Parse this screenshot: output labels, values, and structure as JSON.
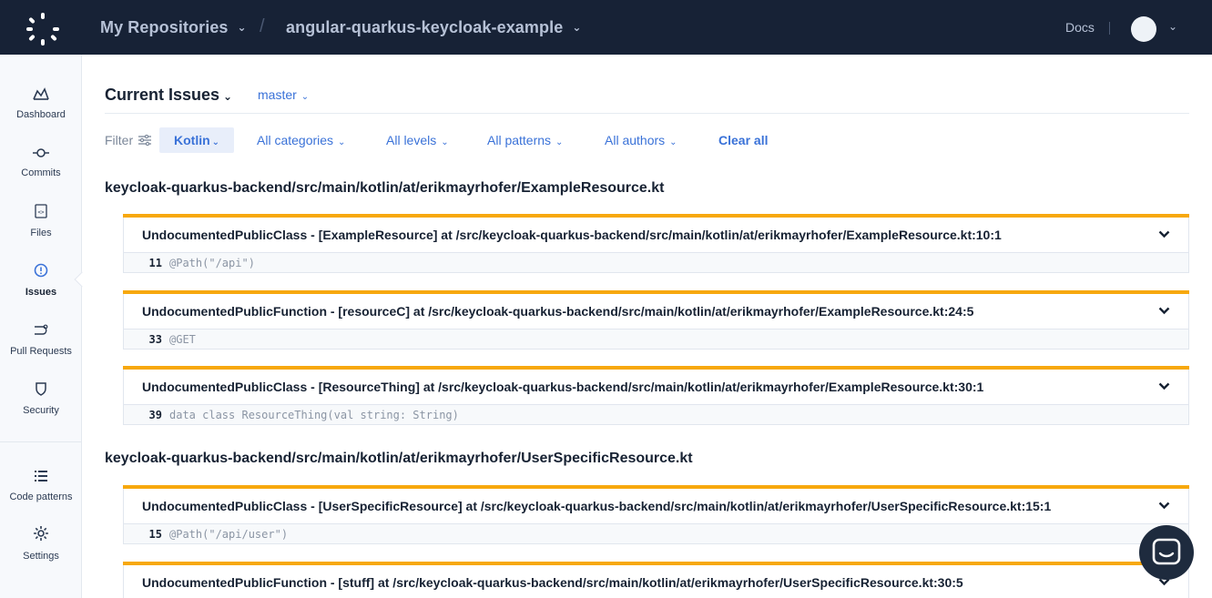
{
  "header": {
    "repos_label": "My Repositories",
    "repo_name": "angular-quarkus-keycloak-example",
    "docs_label": "Docs"
  },
  "sidebar": {
    "items": [
      {
        "label": "Dashboard",
        "icon": "chart-icon"
      },
      {
        "label": "Commits",
        "icon": "commit-icon"
      },
      {
        "label": "Files",
        "icon": "file-icon"
      },
      {
        "label": "Issues",
        "icon": "alert-circle-icon",
        "active": true
      },
      {
        "label": "Pull Requests",
        "icon": "pull-request-icon"
      },
      {
        "label": "Security",
        "icon": "shield-icon"
      },
      {
        "label": "Code patterns",
        "icon": "list-icon"
      },
      {
        "label": "Settings",
        "icon": "gear-icon"
      }
    ]
  },
  "main": {
    "title": "Current Issues",
    "branch": "master",
    "filter_label": "Filter",
    "filters": {
      "language": "Kotlin",
      "categories": "All categories",
      "levels": "All levels",
      "patterns": "All patterns",
      "authors": "All authors",
      "clear": "Clear all"
    },
    "files": [
      {
        "path": "keycloak-quarkus-backend/src/main/kotlin/at/erikmayrhofer/ExampleResource.kt",
        "issues": [
          {
            "title": "UndocumentedPublicClass - [ExampleResource] at /src/keycloak-quarkus-backend/src/main/kotlin/at/erikmayrhofer/ExampleResource.kt:10:1",
            "line": "11",
            "code": "@Path(\"/api\")"
          },
          {
            "title": "UndocumentedPublicFunction - [resourceC] at /src/keycloak-quarkus-backend/src/main/kotlin/at/erikmayrhofer/ExampleResource.kt:24:5",
            "line": "33",
            "code": "@GET"
          },
          {
            "title": "UndocumentedPublicClass - [ResourceThing] at /src/keycloak-quarkus-backend/src/main/kotlin/at/erikmayrhofer/ExampleResource.kt:30:1",
            "line": "39",
            "code": "data class ResourceThing(val string: String)"
          }
        ]
      },
      {
        "path": "keycloak-quarkus-backend/src/main/kotlin/at/erikmayrhofer/UserSpecificResource.kt",
        "issues": [
          {
            "title": "UndocumentedPublicClass - [UserSpecificResource] at /src/keycloak-quarkus-backend/src/main/kotlin/at/erikmayrhofer/UserSpecificResource.kt:15:1",
            "line": "15",
            "code": "@Path(\"/api/user\")"
          },
          {
            "title": "UndocumentedPublicFunction - [stuff] at /src/keycloak-quarkus-backend/src/main/kotlin/at/erikmayrhofer/UserSpecificResource.kt:30:5"
          }
        ]
      }
    ]
  },
  "colors": {
    "topbar": "#172236",
    "accent": "#3a72d8",
    "issue_warning": "#f7a80d"
  }
}
